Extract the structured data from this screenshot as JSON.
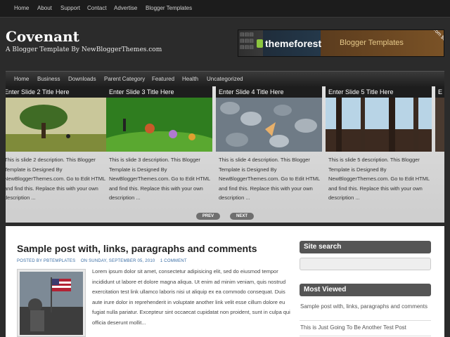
{
  "topnav": [
    "Home",
    "About",
    "Support",
    "Contact",
    "Advertise",
    "Blogger Templates"
  ],
  "header": {
    "title": "Covenant",
    "description": "A Blogger Template By NewBloggerThemes.com"
  },
  "banner": {
    "brand": "themeforest",
    "label": "Blogger Templates",
    "corner": "From $5"
  },
  "mainnav": [
    "Home",
    "Business",
    "Downloads",
    "Parent Category",
    "Featured",
    "Health",
    "Uncategorized"
  ],
  "slider": {
    "slides": [
      {
        "title": "Enter Slide 2 Title Here",
        "description": "This is slide 2 description. This Blogger Template is Designed By NewBloggerThemes.com. Go to Edit HTML and find this. Replace this with your own description ..."
      },
      {
        "title": "Enter Slide 3 Title Here",
        "description": "This is slide 3 description. This Blogger Template is Designed By NewBloggerThemes.com. Go to Edit HTML and find this. Replace this with your own description ..."
      },
      {
        "title": "Enter Slide 4 Title Here",
        "description": "This is slide 4 description. This Blogger Template is Designed By NewBloggerThemes.com. Go to Edit HTML and find this. Replace this with your own description ..."
      },
      {
        "title": "Enter Slide 5 Title Here",
        "description": "This is slide 5 description. This Blogger Template is Designed By NewBloggerThemes.com. Go to Edit HTML and find this. Replace this with your own description ..."
      }
    ],
    "prev_label": "PREV",
    "next_label": "NEXT"
  },
  "post": {
    "title": "Sample post with, links, paragraphs and comments",
    "meta_author": "POSTED BY PBTEMPLATES",
    "meta_date": "ON SUNDAY, SEPTEMBER 05, 2010",
    "meta_comments": "1 COMMENT",
    "body": "Lorem ipsum dolor sit amet, consectetur adipisicing elit, sed do eiusmod tempor incididunt ut labore et dolore magna aliqua. Ut enim ad minim veniam, quis nostrud exercitation test link ullamco laboris nisi ut aliquip ex ea commodo consequat. Duis aute irure dolor in reprehenderit in voluptate another link velit esse cillum dolore eu fugiat nulla pariatur. Excepteur sint occaecat cupidatat non proident, sunt in culpa qui officia deserunt mollit..."
  },
  "sidebar": {
    "search_title": "Site search",
    "most_viewed_title": "Most Viewed",
    "most_viewed": [
      "Sample post with, links, paragraphs and comments",
      "This is Just Going To Be Another Test Post"
    ]
  }
}
